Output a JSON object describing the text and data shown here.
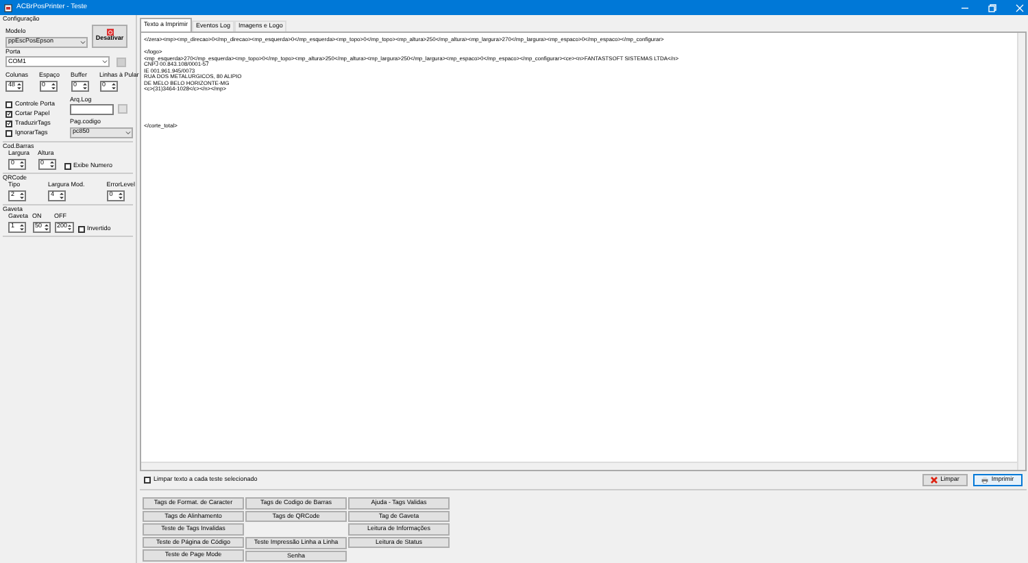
{
  "window": {
    "title": "ACBrPosPrinter - Teste"
  },
  "config": {
    "title": "Configuração",
    "model_label": "Modelo",
    "model_value": "ppEscPosEpson",
    "disable_button": "Desativar",
    "port_label": "Porta",
    "port_value": "COM1",
    "spinners": [
      {
        "label": "Colunas",
        "value": "48"
      },
      {
        "label": "Espaço",
        "value": "0"
      },
      {
        "label": "Buffer",
        "value": "0"
      },
      {
        "label": "Linhas à Pular",
        "value": "0"
      }
    ],
    "checks": [
      {
        "label": "Controle Porta",
        "checked": false
      },
      {
        "label": "Cortar Papel",
        "checked": true
      },
      {
        "label": "TraduzirTags",
        "checked": true
      },
      {
        "label": "IgnorarTags",
        "checked": false
      }
    ],
    "log_label": "Arq.Log",
    "codepage_label": "Pag.codigo",
    "codepage_value": "pc850"
  },
  "barcode": {
    "title": "Cod.Barras",
    "spinners": [
      {
        "label": "Largura",
        "value": "0"
      },
      {
        "label": "Altura",
        "value": "0"
      }
    ],
    "check": {
      "label": "Exibe Numero",
      "checked": false
    }
  },
  "qrcode": {
    "title": "QRCode",
    "spinners": [
      {
        "label": "Tipo",
        "value": "2"
      },
      {
        "label": "Largura Mod.",
        "value": "4"
      },
      {
        "label": "ErrorLevel",
        "value": "0"
      }
    ]
  },
  "drawer": {
    "title": "Gaveta",
    "spinners": [
      {
        "label": "Gaveta",
        "value": "1"
      },
      {
        "label": "ON",
        "value": "50"
      },
      {
        "label": "OFF",
        "value": "200"
      }
    ],
    "check": {
      "label": "Invertido",
      "checked": false
    }
  },
  "tabs": [
    {
      "label": "Texto a Imprimir",
      "selected": true
    },
    {
      "label": "Eventos Log",
      "selected": false
    },
    {
      "label": "Imagens e Logo",
      "selected": false
    }
  ],
  "editor_text": "</zera><mp><mp_direcao>0</mp_direcao><mp_esquerda>0</mp_esquerda><mp_topo>0</mp_topo><mp_altura>250</mp_altura><mp_largura>270</mp_largura><mp_espaco>0</mp_espaco></mp_configurar>\n\n</logo>\n<mp_esquerda>270</mp_esquerda><mp_topo>0</mp_topo><mp_altura>250</mp_altura><mp_largura>250</mp_largura><mp_espaco>0</mp_espaco></mp_configurar><ce><n>FANTASTSOFT SISTEMAS LTDA</n>\nCNPJ 00.843.108/0001-57\nIE 001.961.945/0073\nRUA DOS METALURGICOS, 80 ALIPIO\nDE MELO BELO HORIZONTE-MG\n<c>(31)3464-1028</c></n></mp>\n\n\n\n\n\n</corte_total>",
  "clear_check": {
    "label": "Limpar texto a cada teste selecionado",
    "checked": false
  },
  "test_buttons": [
    [
      {
        "label": "Tags de Format. de Caracter"
      },
      {
        "label": "Tags de Alinhamento"
      },
      {
        "label": "Teste de Tags Invalidas"
      },
      {
        "label": "Teste de Página de Código"
      },
      {
        "label": "Teste de Page Mode"
      }
    ],
    [
      {
        "label": "Tags de Codigo de Barras"
      },
      {
        "label": "Tags de QRCode"
      },
      {
        "label": "Teste Impressão Linha a Linha"
      },
      {
        "label": "Senha"
      }
    ],
    [
      {
        "label": "Ajuda - Tags Validas"
      },
      {
        "label": "Tag de Gaveta"
      },
      {
        "label": "Leitura de Informações"
      },
      {
        "label": "Leitura de Status"
      }
    ]
  ],
  "clear_button": "Limpar",
  "print_button": "Imprimir"
}
